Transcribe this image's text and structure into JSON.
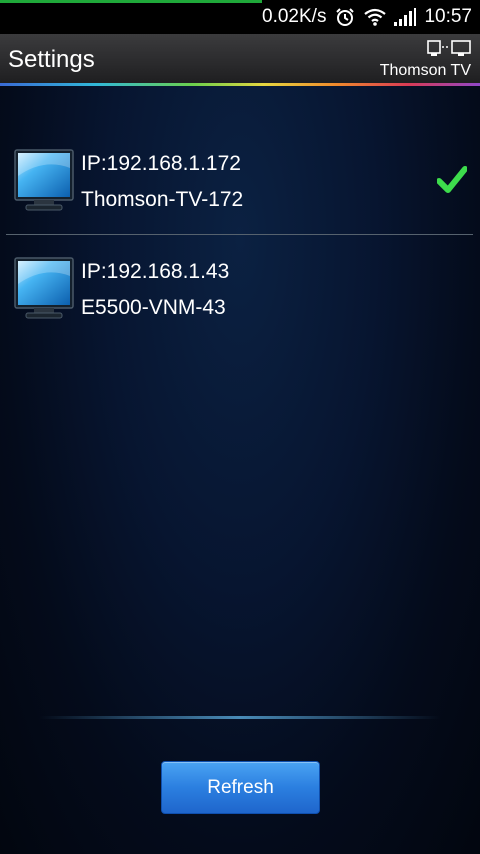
{
  "status_bar": {
    "network_speed": "0.02K/s",
    "time": "10:57",
    "icons": [
      "alarm-icon",
      "wifi-icon",
      "signal-icon"
    ]
  },
  "header": {
    "title": "Settings",
    "switch_icon": "tv-switch-icon",
    "current_tv": "Thomson TV"
  },
  "devices": [
    {
      "ip": "IP:192.168.1.172",
      "name": "Thomson-TV-172",
      "selected": true
    },
    {
      "ip": "IP:192.168.1.43",
      "name": "E5500-VNM-43",
      "selected": false
    }
  ],
  "actions": {
    "refresh_label": "Refresh"
  },
  "colors": {
    "accent": "#2b7fe0",
    "check": "#3ddc4c",
    "signal_bar": "#1fa83a"
  }
}
